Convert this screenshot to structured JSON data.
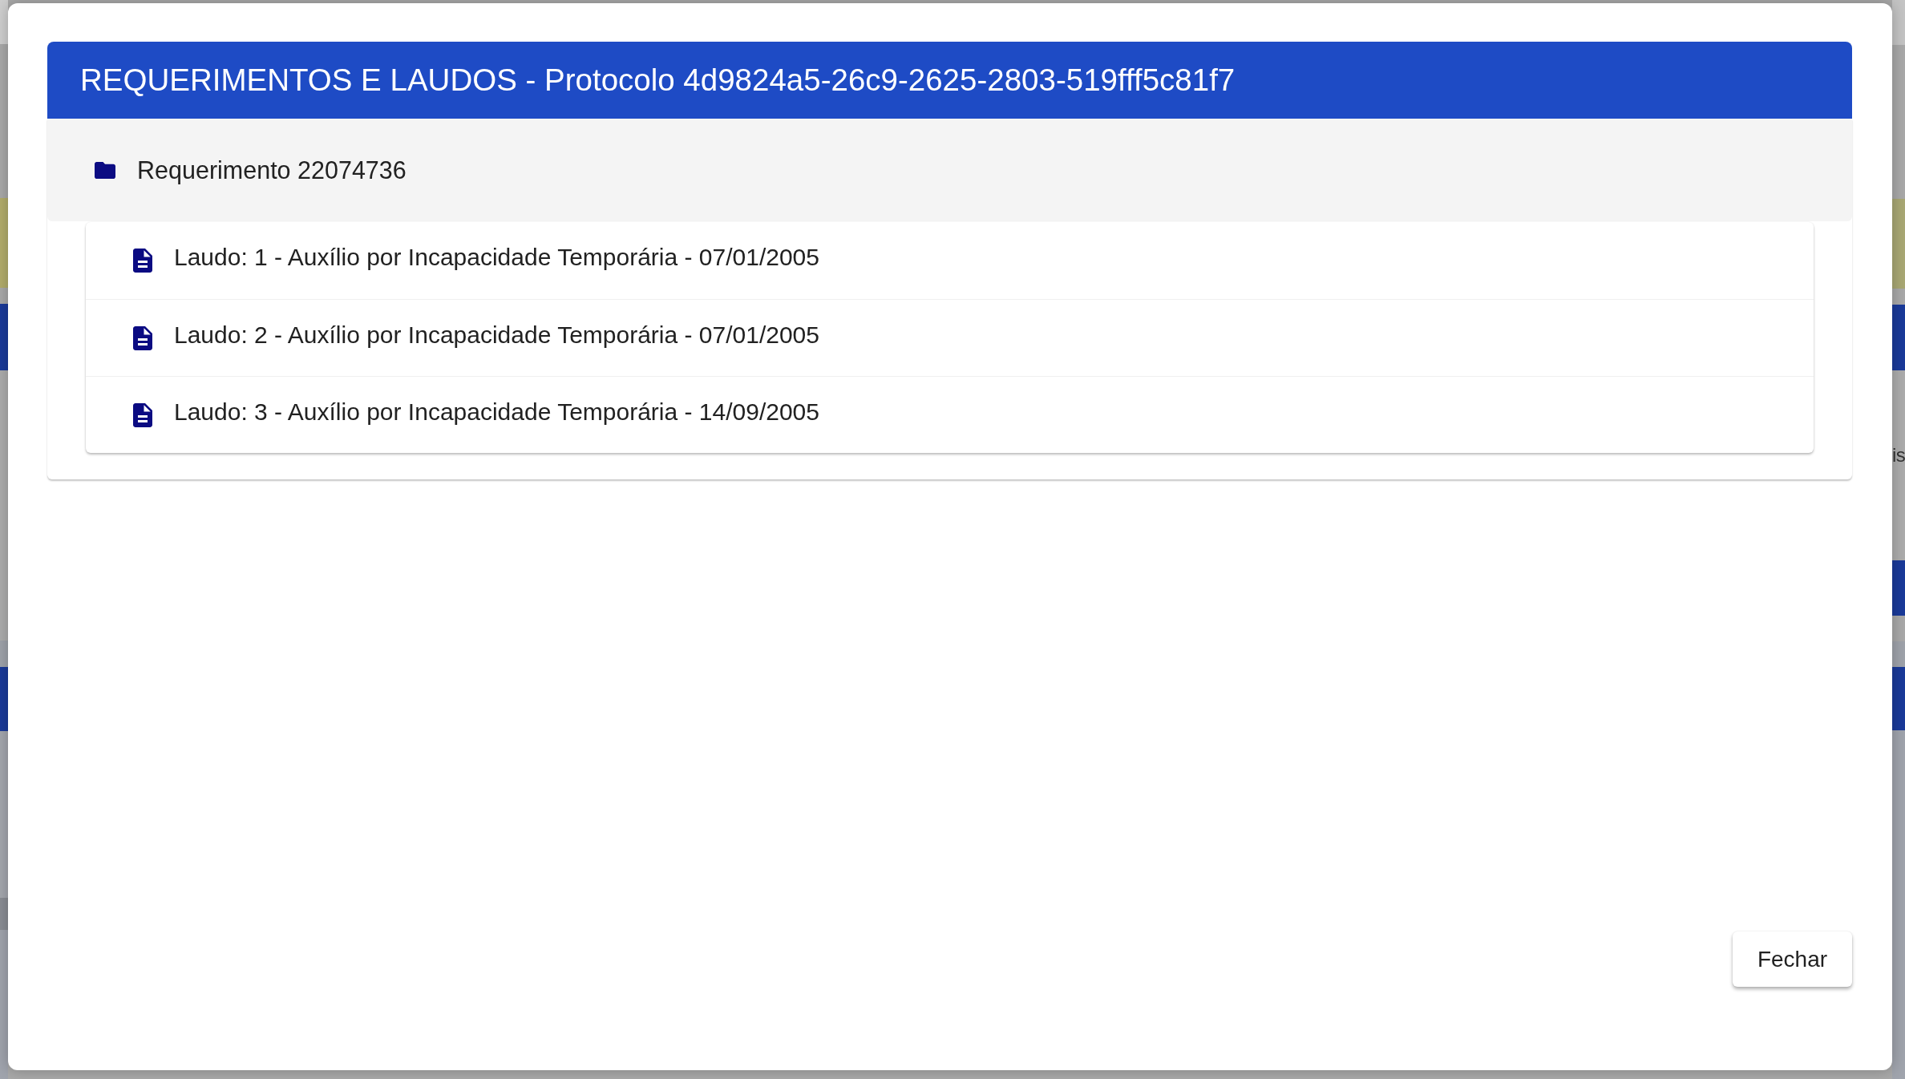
{
  "background_page": {
    "right_edge_texts": [
      "is"
    ]
  },
  "dialog": {
    "title": "REQUERIMENTOS E LAUDOS - Protocolo 4d9824a5-26c9-2625-2803-519fff5c81f7",
    "requerimentos": [
      {
        "label": "Requerimento 22074736",
        "expanded": true,
        "children": [
          {
            "label": "Laudo: 1 - Auxílio por Incapacidade Temporária - 07/01/2005"
          },
          {
            "label": "Laudo: 2 - Auxílio por Incapacidade Temporária - 07/01/2005"
          },
          {
            "label": "Laudo: 3 - Auxílio por Incapacidade Temporária - 14/09/2005"
          }
        ]
      }
    ],
    "buttons": [
      {
        "label": "Fechar"
      }
    ]
  }
}
